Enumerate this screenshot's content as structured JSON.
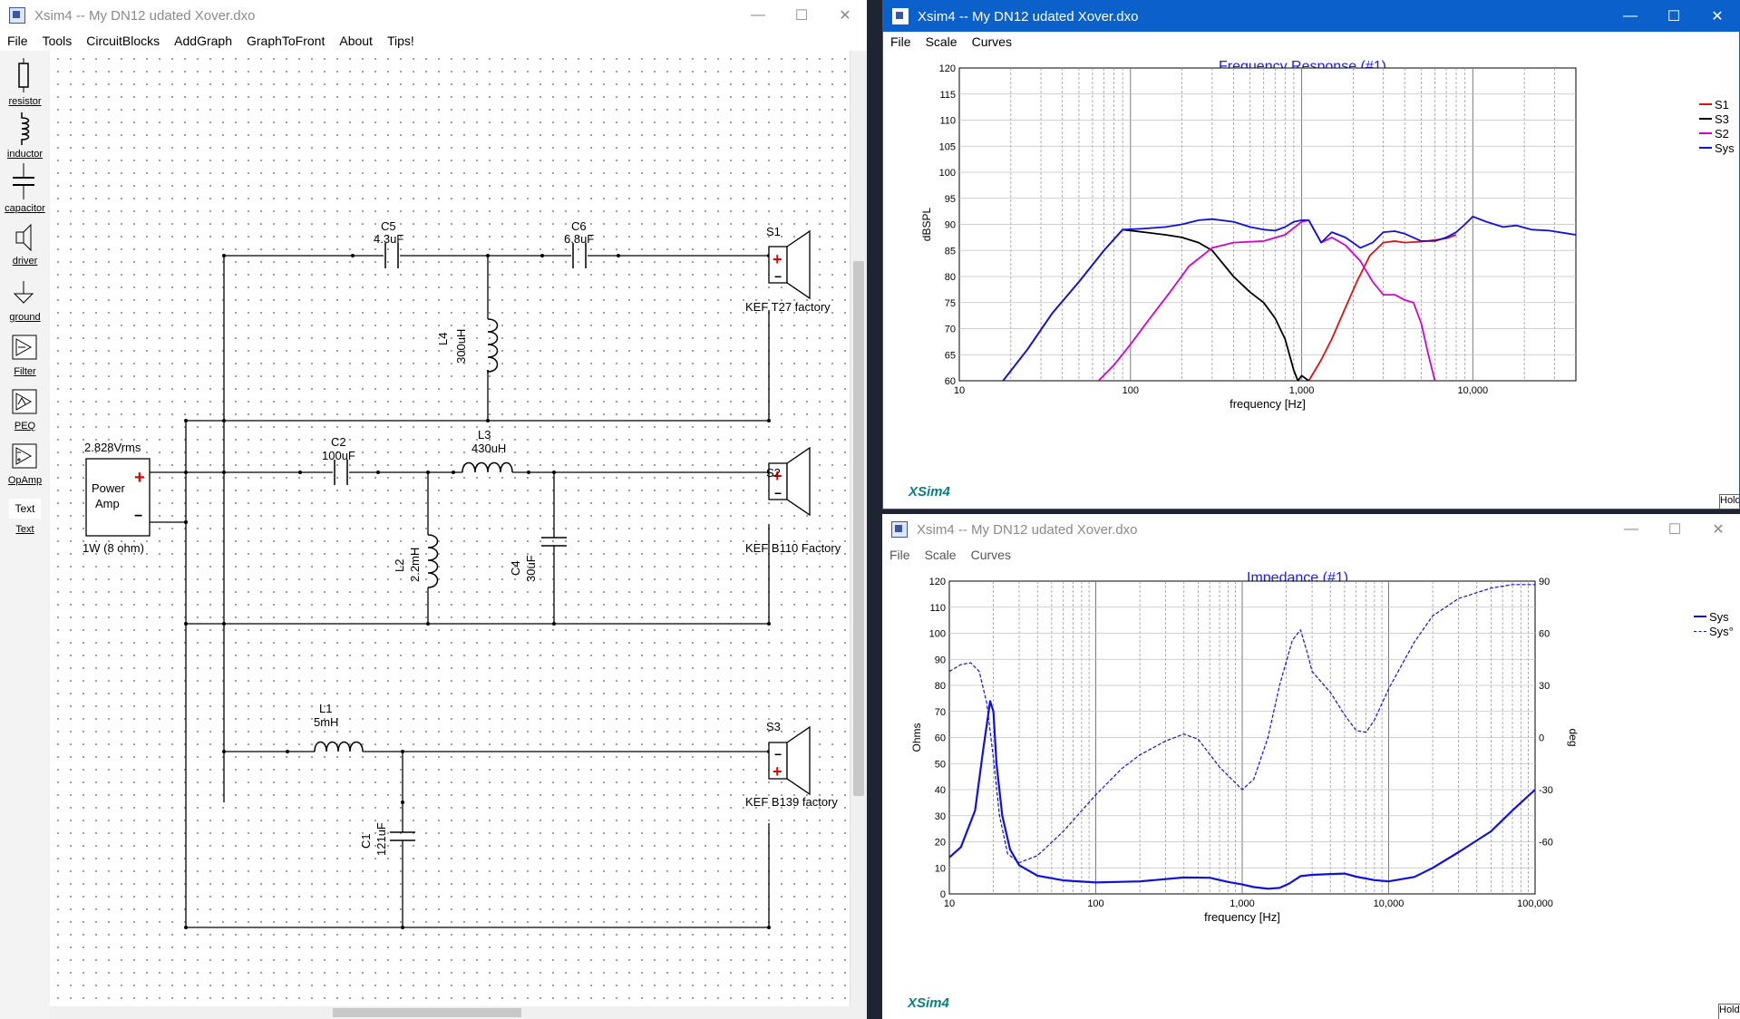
{
  "circuit_window": {
    "title": "Xsim4 -- My DN12 udated Xover.dxo",
    "menu": [
      "File",
      "Tools",
      "CircuitBlocks",
      "AddGraph",
      "GraphToFront",
      "About",
      "Tips!"
    ],
    "palette": [
      {
        "label": "resistor",
        "icon": "resistor-icon"
      },
      {
        "label": "inductor",
        "icon": "inductor-icon"
      },
      {
        "label": "capacitor",
        "icon": "capacitor-icon"
      },
      {
        "label": "driver",
        "icon": "driver-icon"
      },
      {
        "label": "ground",
        "icon": "ground-icon"
      },
      {
        "label": "Filter",
        "icon": "filter-icon"
      },
      {
        "label": "PEQ",
        "icon": "peq-icon"
      },
      {
        "label": "OpAmp",
        "icon": "opamp-icon"
      },
      {
        "label": "Text",
        "icon": "text-icon"
      }
    ],
    "text_icon_glyph": "Text",
    "source": {
      "voltage": "2.828Vrms",
      "name_line1": "Power",
      "name_line2": "Amp",
      "load": "1W (8 ohm)"
    },
    "components": {
      "C5": {
        "name": "C5",
        "value": "4.3uF"
      },
      "C6": {
        "name": "C6",
        "value": "6.8uF"
      },
      "L4": {
        "name": "L4",
        "value": "300uH"
      },
      "C2": {
        "name": "C2",
        "value": "100uF"
      },
      "L3": {
        "name": "L3",
        "value": "430uH"
      },
      "L2": {
        "name": "L2",
        "value": "2.2mH"
      },
      "C4": {
        "name": "C4",
        "value": "30uF"
      },
      "L1": {
        "name": "L1",
        "value": "5mH"
      },
      "C1": {
        "name": "C1",
        "value": "121uF"
      }
    },
    "drivers": {
      "S1": {
        "name": "S1",
        "model": "KEF T27 factory"
      },
      "S2": {
        "name": "S2",
        "model": "KEF B110 Factory"
      },
      "S3": {
        "name": "S3",
        "model": "KEF B139 factory"
      }
    }
  },
  "fr_window": {
    "title": "Xsim4 -- My DN12 udated Xover.dxo",
    "menu": [
      "File",
      "Scale",
      "Curves"
    ],
    "brand": "XSim4",
    "hold_label": "Hold",
    "accent_color": "#0b60c9"
  },
  "imp_window": {
    "title": "Xsim4 -- My DN12 udated Xover.dxo",
    "menu": [
      "File",
      "Scale",
      "Curves"
    ],
    "brand": "XSim4",
    "hold_label": "Hold"
  },
  "chart_data": [
    {
      "type": "line",
      "title": "Frequency Response (#1)",
      "xlabel": "frequency [Hz]",
      "ylabel": "dBSPL",
      "xscale": "log",
      "xlim": [
        10,
        40000
      ],
      "ylim": [
        60,
        120
      ],
      "x_tick_labels": [
        "10",
        "100",
        "1,000",
        "10,000"
      ],
      "y_tick_labels": [
        "60",
        "65",
        "70",
        "75",
        "80",
        "85",
        "90",
        "95",
        "100",
        "105",
        "110",
        "115",
        "120"
      ],
      "legend_position": "right",
      "grid": true,
      "series": [
        {
          "name": "S1",
          "color": "#e01010",
          "x": [
            1000,
            1100,
            1300,
            1500,
            1800,
            2100,
            2500,
            3000,
            3500,
            4000,
            5000,
            6000,
            7000,
            8000
          ],
          "y": [
            54,
            60,
            64,
            68,
            74,
            79,
            84,
            86.5,
            86.8,
            86.5,
            86.7,
            87,
            87.3,
            88
          ]
        },
        {
          "name": "S3",
          "color": "#000000",
          "x": [
            18,
            25,
            35,
            50,
            70,
            90,
            120,
            160,
            200,
            250,
            300,
            400,
            500,
            600,
            700,
            800,
            900,
            950,
            1000,
            1100
          ],
          "y": [
            60,
            66,
            73,
            79,
            85,
            89,
            88.5,
            88,
            87.5,
            86.5,
            85,
            80,
            77,
            75,
            72,
            68,
            62,
            60,
            61,
            60
          ]
        },
        {
          "name": "S2",
          "color": "#d400d4",
          "x": [
            65,
            80,
            100,
            130,
            170,
            220,
            300,
            400,
            600,
            800,
            1000,
            1100,
            1300,
            1500,
            1800,
            2200,
            2600,
            3000,
            3500,
            4000,
            4500,
            5000,
            5500,
            6000
          ],
          "y": [
            60,
            63,
            67,
            72,
            77,
            82,
            85.5,
            86.5,
            86.8,
            88,
            90.5,
            90.8,
            86.5,
            87.5,
            86,
            83,
            79,
            76.5,
            76.5,
            75.5,
            75,
            71,
            65,
            60
          ]
        },
        {
          "name": "Sys",
          "color": "#1010e0",
          "x": [
            18,
            25,
            35,
            50,
            70,
            90,
            120,
            160,
            200,
            250,
            300,
            400,
            500,
            600,
            700,
            800,
            900,
            1000,
            1100,
            1300,
            1500,
            1800,
            2200,
            2600,
            3000,
            3500,
            4000,
            5000,
            6000,
            7000,
            8000,
            9000,
            10000,
            12000,
            15000,
            18000,
            22000,
            28000,
            35000,
            40000
          ],
          "y": [
            60,
            66,
            73,
            79,
            85,
            89,
            89.2,
            89.5,
            90,
            90.8,
            91,
            90.5,
            89.5,
            89,
            88.8,
            89.5,
            90.5,
            90.8,
            90.8,
            86.5,
            88.5,
            87.5,
            85.5,
            86.5,
            88.5,
            88.7,
            88.2,
            86.8,
            86.8,
            87.5,
            88.5,
            90,
            91.5,
            90.5,
            89.5,
            89.8,
            89,
            88.8,
            88.3,
            88
          ]
        }
      ]
    },
    {
      "type": "line",
      "title": "Impedance (#1)",
      "xlabel": "frequency [Hz]",
      "ylabel": "Ohms",
      "y2label": "deg",
      "xscale": "log",
      "xlim": [
        10,
        100000
      ],
      "ylim": [
        0,
        120
      ],
      "y2lim": [
        -90,
        90
      ],
      "x_tick_labels": [
        "10",
        "100",
        "1,000",
        "10,000",
        "100,000"
      ],
      "y_tick_labels": [
        "0",
        "10",
        "20",
        "30",
        "40",
        "50",
        "60",
        "70",
        "80",
        "90",
        "100",
        "110",
        "120"
      ],
      "y2_tick_labels": [
        "-60",
        "-30",
        "0",
        "30",
        "60",
        "90"
      ],
      "legend_position": "right",
      "grid": true,
      "series": [
        {
          "name": "Sys",
          "color": "#1010e0",
          "style": "solid",
          "axis": "left",
          "x": [
            10,
            12,
            15,
            17,
            19,
            20,
            21,
            23,
            26,
            30,
            40,
            60,
            100,
            200,
            400,
            600,
            800,
            1000,
            1200,
            1500,
            1800,
            2100,
            2500,
            3000,
            4000,
            5000,
            6000,
            8000,
            10000,
            15000,
            20000,
            30000,
            50000,
            70000,
            100000
          ],
          "y": [
            14,
            18,
            32,
            55,
            74,
            70,
            50,
            30,
            17,
            11,
            7,
            5.2,
            4.4,
            4.8,
            6.3,
            6.2,
            4.6,
            3.6,
            2.6,
            2,
            2.3,
            4,
            6.8,
            7.3,
            7.6,
            7.8,
            6.6,
            5.3,
            4.8,
            6.5,
            10,
            16,
            24,
            32,
            40
          ]
        },
        {
          "name": "Sys°",
          "color": "#1010e0",
          "style": "dashed",
          "axis": "right",
          "x": [
            10,
            12,
            14,
            16,
            18,
            20,
            22,
            25,
            30,
            40,
            60,
            100,
            150,
            200,
            300,
            400,
            500,
            700,
            1000,
            1200,
            1500,
            1800,
            2200,
            2500,
            2800,
            3000,
            4000,
            5000,
            6000,
            7000,
            8000,
            10000,
            15000,
            20000,
            30000,
            50000,
            70000,
            100000
          ],
          "y": [
            38,
            42,
            43,
            38,
            20,
            -12,
            -45,
            -67,
            -72,
            -68,
            -54,
            -33,
            -18,
            -10,
            -2,
            2,
            -1,
            -17,
            -30,
            -24,
            0,
            30,
            56,
            62,
            48,
            38,
            26,
            13,
            4,
            3,
            10,
            28,
            55,
            70,
            80,
            86,
            88,
            88
          ]
        }
      ]
    }
  ]
}
